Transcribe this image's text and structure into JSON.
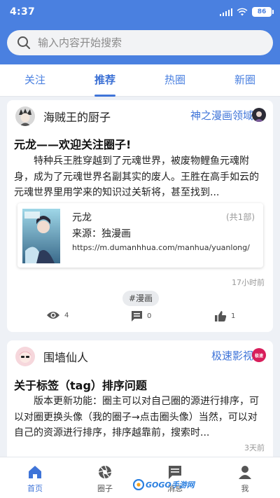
{
  "status_bar": {
    "time": "4:37",
    "battery": "86"
  },
  "search": {
    "placeholder": "输入内容开始搜索"
  },
  "tabs": [
    {
      "label": "关注",
      "active": false
    },
    {
      "label": "推荐",
      "active": true
    },
    {
      "label": "热圈",
      "active": false
    },
    {
      "label": "新圈",
      "active": false
    }
  ],
  "posts": [
    {
      "user": "海贼王的厨子",
      "circle": "神之漫画领域",
      "title": "元龙——欢迎关注圈子!",
      "body": "特种兵王胜穿越到了元魂世界，被废物鲤鱼元魂附身，成为了元魂世界名副其实的废人。王胜在高手如云的元魂世界里用学来的知识过关斩将，甚至找到...",
      "resource": {
        "name": "元龙",
        "count": "(共1部)",
        "source": "来源：独漫画",
        "url": "https://m.dumanhhua.com/manhua/yuanlong/"
      },
      "time": "17小时前",
      "tag": "#漫画",
      "views": "4",
      "comments": "0",
      "likes": "1"
    },
    {
      "user": "围墙仙人",
      "circle": "极速影视",
      "circle_badge": "极速",
      "title": "关于标签（tag）排序问题",
      "body": "版本更新功能：圈主可以对自己圈的源进行排序，可以对圈更换头像（我的圈子→点击圈头像）当然，可以对自己的资源进行排序，排序越靠前，搜索时...",
      "time": "3天前"
    }
  ],
  "bottom_nav": [
    {
      "label": "首页",
      "icon": "home-icon",
      "active": true
    },
    {
      "label": "圈子",
      "icon": "aperture-icon",
      "active": false
    },
    {
      "label": "消息",
      "icon": "message-icon",
      "active": false
    },
    {
      "label": "我",
      "icon": "person-icon",
      "active": false
    }
  ],
  "watermark": {
    "text": "GOGO手游网"
  },
  "colors": {
    "primary": "#4a80e0",
    "accent": "#3f74d8",
    "background": "#eef1f6"
  }
}
